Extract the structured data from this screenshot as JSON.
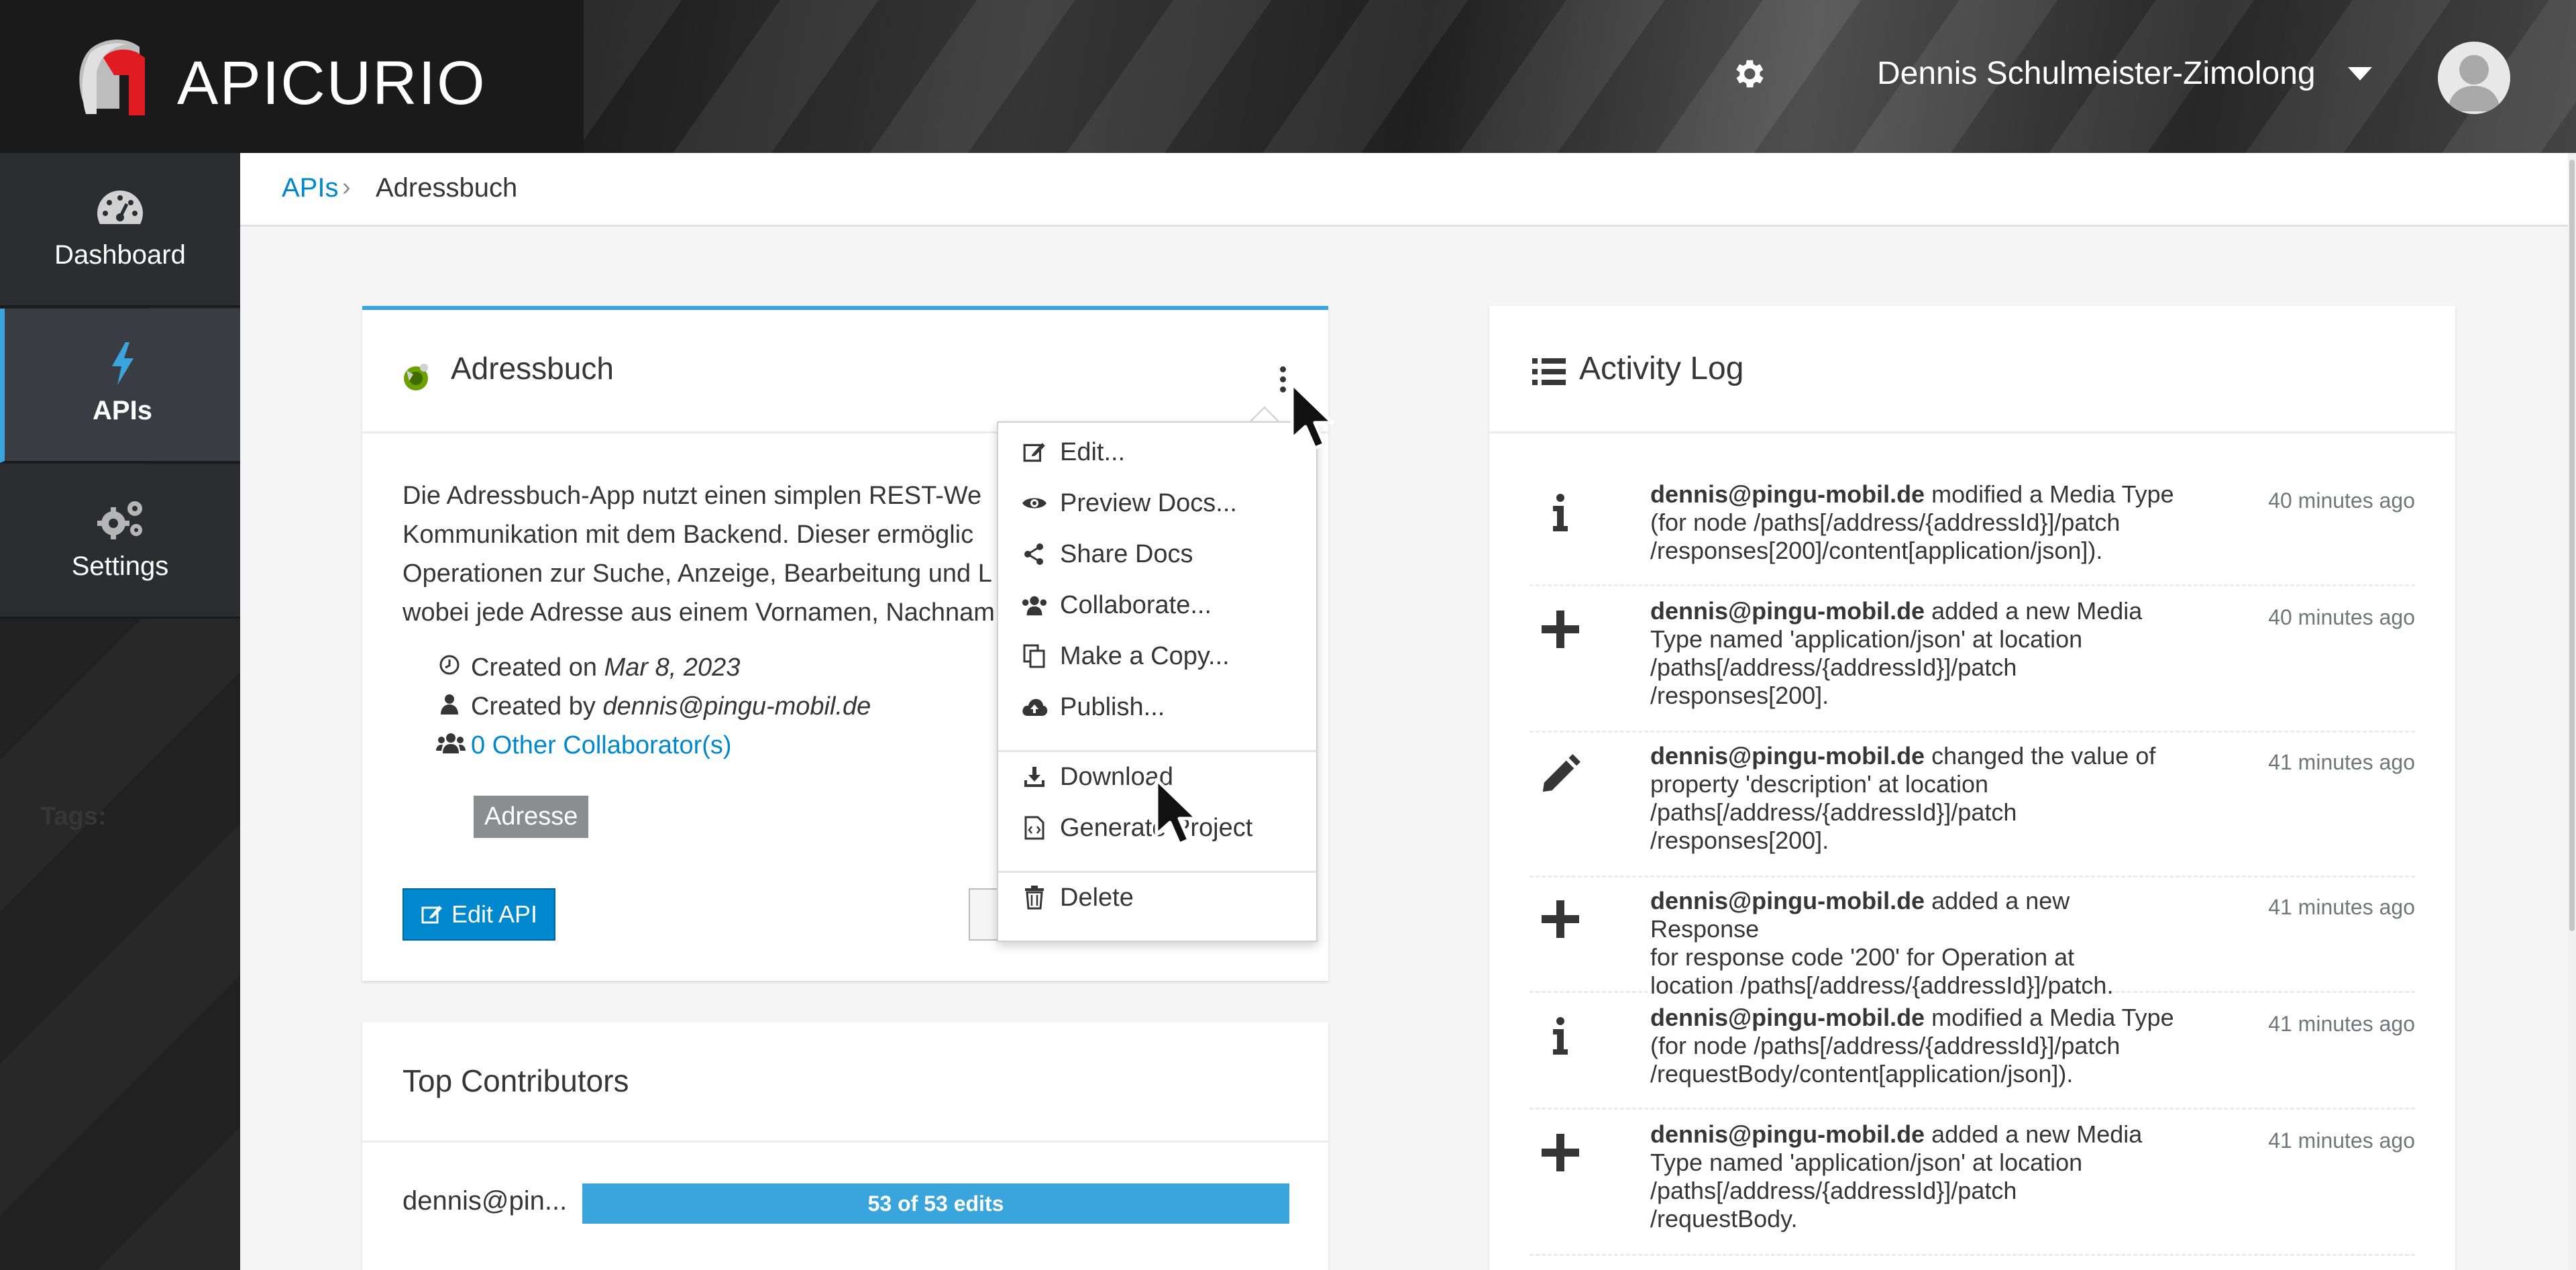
{
  "header": {
    "brand": "APICURIO",
    "user_name": "Dennis Schulmeister-Zimolong",
    "brand_color": "#e11b22",
    "accent_color": "#39a5dc"
  },
  "sidebar": {
    "items": [
      {
        "label": "Dashboard",
        "icon": "dashboard-gauge-icon",
        "active": false
      },
      {
        "label": "APIs",
        "icon": "bolt-icon",
        "active": true
      },
      {
        "label": "Settings",
        "icon": "gears-icon",
        "active": false
      }
    ]
  },
  "breadcrumb": {
    "parent": "APIs",
    "separator": "›",
    "current": "Adressbuch"
  },
  "api_card": {
    "title": "Adressbuch",
    "description_lines": [
      "Die Adressbuch-App nutzt einen simplen REST-We",
      "Kommunikation mit dem Backend. Dieser ermöglic",
      "Operationen zur Suche, Anzeige, Bearbeitung und L",
      "wobei jede Adresse aus einem Vornamen, Nachnam"
    ],
    "created_on_label": "Created on",
    "created_on": "Mar 8, 2023",
    "created_by_label": "Created by",
    "created_by": "dennis@pingu-mobil.de",
    "collaborators": "0 Other Collaborator(s)",
    "tags_label": "Tags:",
    "tag": "Adresse",
    "edit_button": "Edit API"
  },
  "menu": {
    "items": [
      {
        "label": "Edit...",
        "icon": "edit-icon"
      },
      {
        "label": "Preview Docs...",
        "icon": "eye-icon"
      },
      {
        "label": "Share Docs",
        "icon": "share-icon"
      },
      {
        "label": "Collaborate...",
        "icon": "users-icon"
      },
      {
        "label": "Make a Copy...",
        "icon": "copy-icon"
      },
      {
        "label": "Publish...",
        "icon": "cloud-upload-icon"
      },
      {
        "label": "Download",
        "icon": "download-icon"
      },
      {
        "label": "Generate Project",
        "icon": "code-file-icon"
      },
      {
        "label": "Delete",
        "icon": "trash-icon"
      }
    ]
  },
  "contributors": {
    "title": "Top Contributors",
    "name": "dennis@pin...",
    "edits": "53 of 53 edits",
    "edits_count": 53,
    "edits_total": 53
  },
  "activity": {
    "title": "Activity Log",
    "entries": [
      {
        "icon": "info-icon",
        "user": "dennis@pingu-mobil.de",
        "text_lines": [
          " modified a Media Type",
          "(for node /paths[/address/{addressId}]/patch",
          "/responses[200]/content[application/json])."
        ],
        "time": "40 minutes ago"
      },
      {
        "icon": "plus-icon",
        "user": "dennis@pingu-mobil.de",
        "text_lines": [
          " added a new Media",
          "Type named 'application/json' at location",
          "/paths[/address/{addressId}]/patch",
          "/responses[200]."
        ],
        "time": "40 minutes ago"
      },
      {
        "icon": "pencil-icon",
        "user": "dennis@pingu-mobil.de",
        "text_lines": [
          " changed the value of",
          "property 'description' at location",
          "/paths[/address/{addressId}]/patch",
          "/responses[200]."
        ],
        "time": "41 minutes ago"
      },
      {
        "icon": "plus-icon",
        "user": "dennis@pingu-mobil.de",
        "text_lines": [
          " added a new Response",
          "for response code '200' for Operation at",
          "location /paths[/address/{addressId}]/patch."
        ],
        "time": "41 minutes ago"
      },
      {
        "icon": "info-icon",
        "user": "dennis@pingu-mobil.de",
        "text_lines": [
          " modified a Media Type",
          "(for node /paths[/address/{addressId}]/patch",
          "/requestBody/content[application/json])."
        ],
        "time": "41 minutes ago"
      },
      {
        "icon": "plus-icon",
        "user": "dennis@pingu-mobil.de",
        "text_lines": [
          " added a new Media",
          "Type named 'application/json' at location",
          "/paths[/address/{addressId}]/patch",
          "/requestBody."
        ],
        "time": "41 minutes ago"
      }
    ]
  }
}
